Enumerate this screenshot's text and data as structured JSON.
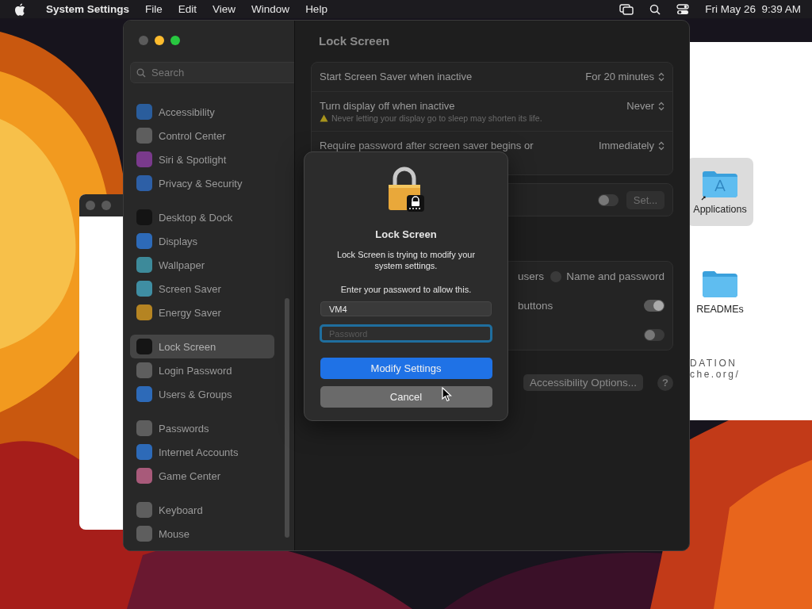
{
  "menubar": {
    "app_name": "System Settings",
    "menus": [
      "File",
      "Edit",
      "View",
      "Window",
      "Help"
    ],
    "clock": "Fri May 26  9:39 AM"
  },
  "finder_window": {
    "items": [
      {
        "label": "Applications",
        "kind": "apps",
        "selected": true
      },
      {
        "label": "READMEs",
        "kind": "folder",
        "selected": false
      }
    ],
    "footer_lines": [
      "DATION",
      "che.org/"
    ]
  },
  "settings_window": {
    "search": {
      "placeholder": "Search"
    },
    "sidebar": {
      "groups": [
        [
          {
            "label": "Accessibility",
            "color": "#2a5d9c",
            "selected": false
          },
          {
            "label": "Control Center",
            "color": "#5e5e5e",
            "selected": false
          },
          {
            "label": "Siri & Spotlight",
            "color": "#7a3a8c",
            "selected": false
          },
          {
            "label": "Privacy & Security",
            "color": "#2d5fa6",
            "selected": false
          }
        ],
        [
          {
            "label": "Desktop & Dock",
            "color": "#141414",
            "selected": false
          },
          {
            "label": "Displays",
            "color": "#2d6ab8",
            "selected": false
          },
          {
            "label": "Wallpaper",
            "color": "#3d8a9a",
            "selected": false
          },
          {
            "label": "Screen Saver",
            "color": "#3f8ea3",
            "selected": false
          },
          {
            "label": "Energy Saver",
            "color": "#b58422",
            "selected": false
          }
        ],
        [
          {
            "label": "Lock Screen",
            "color": "#151515",
            "selected": true
          },
          {
            "label": "Login Password",
            "color": "#5e5e5e",
            "selected": false
          },
          {
            "label": "Users & Groups",
            "color": "#2d6ab8",
            "selected": false
          }
        ],
        [
          {
            "label": "Passwords",
            "color": "#5e5e5e",
            "selected": false
          },
          {
            "label": "Internet Accounts",
            "color": "#2d6ab8",
            "selected": false
          },
          {
            "label": "Game Center",
            "color": "#a85a7a",
            "selected": false
          }
        ],
        [
          {
            "label": "Keyboard",
            "color": "#5e5e5e",
            "selected": false
          },
          {
            "label": "Mouse",
            "color": "#5e5e5e",
            "selected": false
          }
        ]
      ]
    },
    "content": {
      "title": "Lock Screen",
      "sections": [
        {
          "rows": [
            {
              "kind": "popup",
              "label": "Start Screen Saver when inactive",
              "value": "For 20 minutes"
            },
            {
              "kind": "popup",
              "label": "Turn display off when inactive",
              "value": "Never",
              "warning": "Never letting your display go to sleep may shorten its life."
            },
            {
              "kind": "popup",
              "label": "Require password after screen saver begins or",
              "value": "Immediately"
            }
          ]
        },
        {
          "rows": [
            {
              "kind": "toggle_button",
              "on": false,
              "button": "Set..."
            }
          ]
        },
        {
          "rows": [
            {
              "kind": "radio",
              "label": "users",
              "option": "Name and password",
              "selected": false
            },
            {
              "kind": "toggle",
              "label": "buttons",
              "on": true
            },
            {
              "kind": "toggle",
              "on": false
            }
          ]
        }
      ],
      "footer": {
        "button": "Accessibility Options...",
        "help": "?"
      }
    }
  },
  "dialog": {
    "title": "Lock Screen",
    "message": "Lock Screen is trying to modify your system settings.",
    "prompt": "Enter your password to allow this.",
    "username": "VM4",
    "password": {
      "placeholder": "Password"
    },
    "buttons": [
      {
        "label": "Modify Settings",
        "kind": "primary"
      },
      {
        "label": "Cancel",
        "kind": "secondary"
      }
    ]
  }
}
